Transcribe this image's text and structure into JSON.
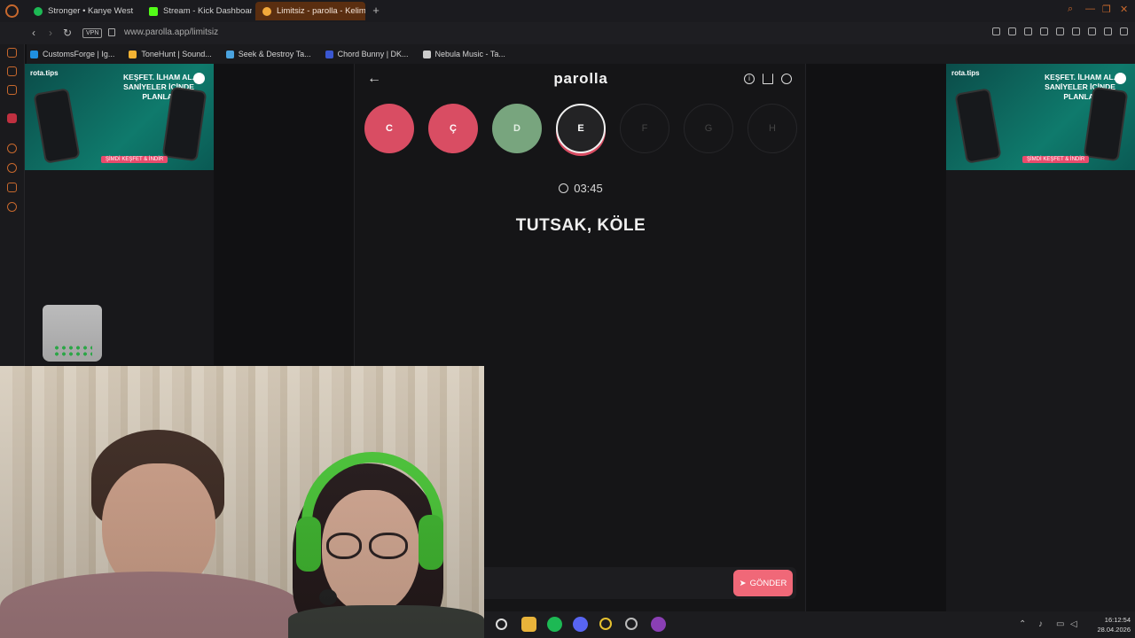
{
  "browser": {
    "tabs": [
      {
        "label": "Stronger • Kanye West",
        "color": "#1db954"
      },
      {
        "label": "Stream - Kick Dashboard",
        "color": "#53fc18"
      },
      {
        "label": "Limitsiz - parolla - Kelime",
        "color": "#f2a93b",
        "active": true
      }
    ],
    "newtab": "+",
    "vpn": "VPN",
    "url_domain": "www.parolla.app",
    "url_path": "/limitsiz"
  },
  "bookmarks": [
    {
      "label": "CustomsForge | Ig...",
      "color": "#1f8fe0"
    },
    {
      "label": "ToneHunt | Sound...",
      "color": "#f2b233"
    },
    {
      "label": "Seek & Destroy Ta...",
      "color": "#4aa3df"
    },
    {
      "label": "Chord Bunny | DK...",
      "color": "#3a57d1"
    },
    {
      "label": "Nebula Music - Ta...",
      "color": "#cccccc"
    }
  ],
  "ads": {
    "brand": "rota.tips",
    "slogan": "KEŞFET. İLHAM AL. SANİYELER İÇİNDE PLANLA!",
    "cta": "ŞİMDİ KEŞFET & İNDİR"
  },
  "game": {
    "logo": "parolla",
    "letters": [
      {
        "char": "C",
        "state": "wrong"
      },
      {
        "char": "Ç",
        "state": "wrong"
      },
      {
        "char": "D",
        "state": "right"
      },
      {
        "char": "E",
        "state": "current"
      },
      {
        "char": "F",
        "state": "pending"
      },
      {
        "char": "G",
        "state": "pending"
      },
      {
        "char": "H",
        "state": "pending"
      }
    ],
    "timer": "03:45",
    "clue": "TUTSAK, KÖLE",
    "answer_value": "",
    "send_label": "GÖNDER",
    "colors": {
      "wrong": "#d94d63",
      "right": "#78a57e",
      "send": "#f06878"
    }
  },
  "taskbar": {
    "time": "16:12:54",
    "date": "28.04.2026"
  }
}
